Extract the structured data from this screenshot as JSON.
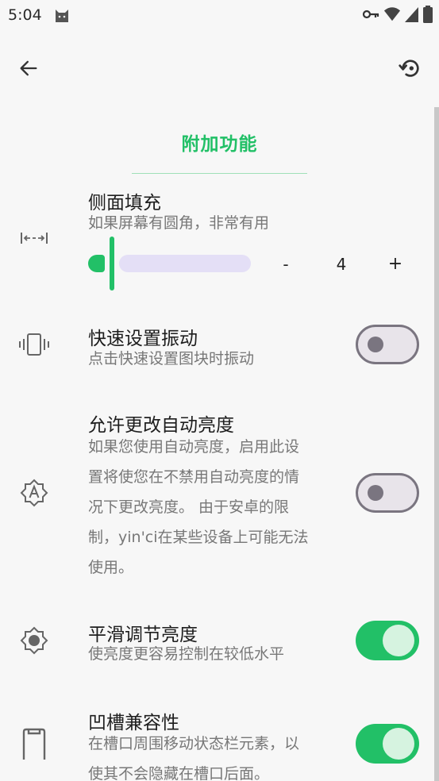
{
  "status_bar": {
    "time": "5:04",
    "icons": [
      "cat-icon",
      "key-icon",
      "wifi-icon",
      "signal-icon",
      "battery-icon"
    ]
  },
  "toolbar": {
    "back_icon": "arrow-left-icon",
    "reset_icon": "restore-icon"
  },
  "section": {
    "title": "附加功能"
  },
  "colors": {
    "accent": "#22c067",
    "slider_track": "#e4dff6",
    "toggle_off": "#7a7580"
  },
  "settings": {
    "side_padding": {
      "title": "侧面填充",
      "subtitle": "如果屏幕有圆角，非常有用",
      "icon": "horizontal-padding-icon",
      "value": "4",
      "minus_label": "-",
      "plus_label": "+"
    },
    "qs_vibration": {
      "title": "快速设置振动",
      "subtitle": "点击快速设置图块时振动",
      "icon": "vibration-icon",
      "enabled": false
    },
    "auto_brightness": {
      "title": "允许更改自动亮度",
      "subtitle_lines": [
        "如果您使用自动亮度，启用此设",
        "置将使您在不禁用自动亮度的情",
        "况下更改亮度。 由于安卓的限",
        "制，yin'ci在某些设备上可能无法",
        "使用。"
      ],
      "icon": "auto-brightness-icon",
      "enabled": false
    },
    "smooth_brightness": {
      "title": "平滑调节亮度",
      "subtitle": "使亮度更容易控制在较低水平",
      "icon": "brightness-icon",
      "enabled": true
    },
    "notch_compat": {
      "title": "凹槽兼容性",
      "subtitle_lines": [
        "在槽口周围移动状态栏元素，以",
        "使其不会隐藏在槽口后面。"
      ],
      "icon": "notch-phone-icon",
      "enabled": true
    }
  }
}
